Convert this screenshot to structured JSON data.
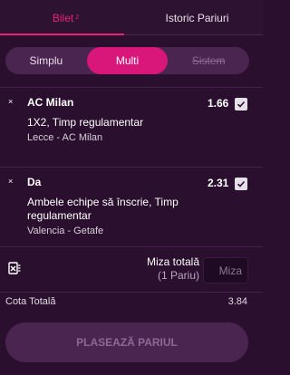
{
  "tabs": {
    "ticket_label": "Bilet",
    "ticket_count": "2",
    "history_label": "Istoric Pariuri"
  },
  "bet_types": [
    "Simplu",
    "Multi",
    "Sistem"
  ],
  "selections": [
    {
      "remove_glyph": "×",
      "name": "AC Milan",
      "odd": "1.66",
      "market": "1X2, Timp regulamentar",
      "event": "Lecce - AC Milan",
      "checked": true
    },
    {
      "remove_glyph": "×",
      "name": "Da",
      "odd": "2.31",
      "market": "Ambele echipe să înscrie, Timp regulamentar",
      "event": "Valencia - Getafe",
      "checked": true
    }
  ],
  "stake": {
    "label": "Miza totală",
    "sublabel": "(1 Pariu)",
    "placeholder": "Miza"
  },
  "totals": {
    "label": "Cota Totală",
    "value": "3.84"
  },
  "place_button": "PLASEAZĂ PARIUL",
  "colors": {
    "background": "#2a0f2e",
    "accent": "#e8217a",
    "panel": "#4a2550"
  },
  "icons": {
    "remove": "close-icon",
    "check": "checkbox-checked-icon",
    "clear": "clear-betslip-icon"
  }
}
